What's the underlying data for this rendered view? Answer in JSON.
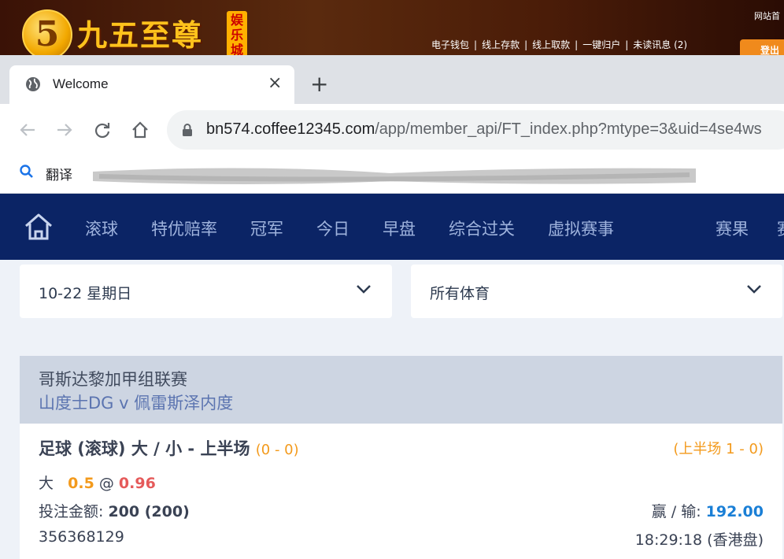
{
  "banner": {
    "logo_digit": "5",
    "logo_text": "九五至尊",
    "logo_badge": "娱乐城",
    "links": [
      "电子钱包",
      "线上存款",
      "线上取款",
      "一键归户",
      "未读讯息 (2)"
    ],
    "site_home": "网站首",
    "logout": "登出"
  },
  "browser": {
    "tab_title": "Welcome",
    "url_host": "bn574.coffee12345.com",
    "url_path": "/app/member_api/FT_index.php?mtype=3&uid=4se4ws",
    "bookmark_label": "翻译"
  },
  "appnav": {
    "items": [
      "滚球",
      "特优赔率",
      "冠军",
      "今日",
      "早盘",
      "综合过关",
      "虚拟赛事",
      "赛果",
      "赛"
    ]
  },
  "filters": {
    "date": "10-22 星期日",
    "sport": "所有体育"
  },
  "bet": {
    "league": "哥斯达黎加甲组联赛",
    "match": "山度士DG   v   佩雷斯泽内度",
    "title": "足球 (滚球) 大 / 小 - 上半场",
    "score": "(0 - 0)",
    "half_score": "(上半场 1 - 0)",
    "pick_label": "大",
    "handicap": "0.5",
    "at": "@",
    "odds": "0.96",
    "stake_label": "投注金额:",
    "stake_value": "200 (200)",
    "winloss_label": "赢 / 输:",
    "winloss_value": "192.00",
    "ticket_id": "356368129",
    "bet_time": "18:29:18 (香港盘)"
  },
  "colors": {
    "nav_bg": "#0b2465",
    "orange": "#f39a1c",
    "odds_red": "#e55a5a",
    "win_blue": "#1a7fd6"
  }
}
